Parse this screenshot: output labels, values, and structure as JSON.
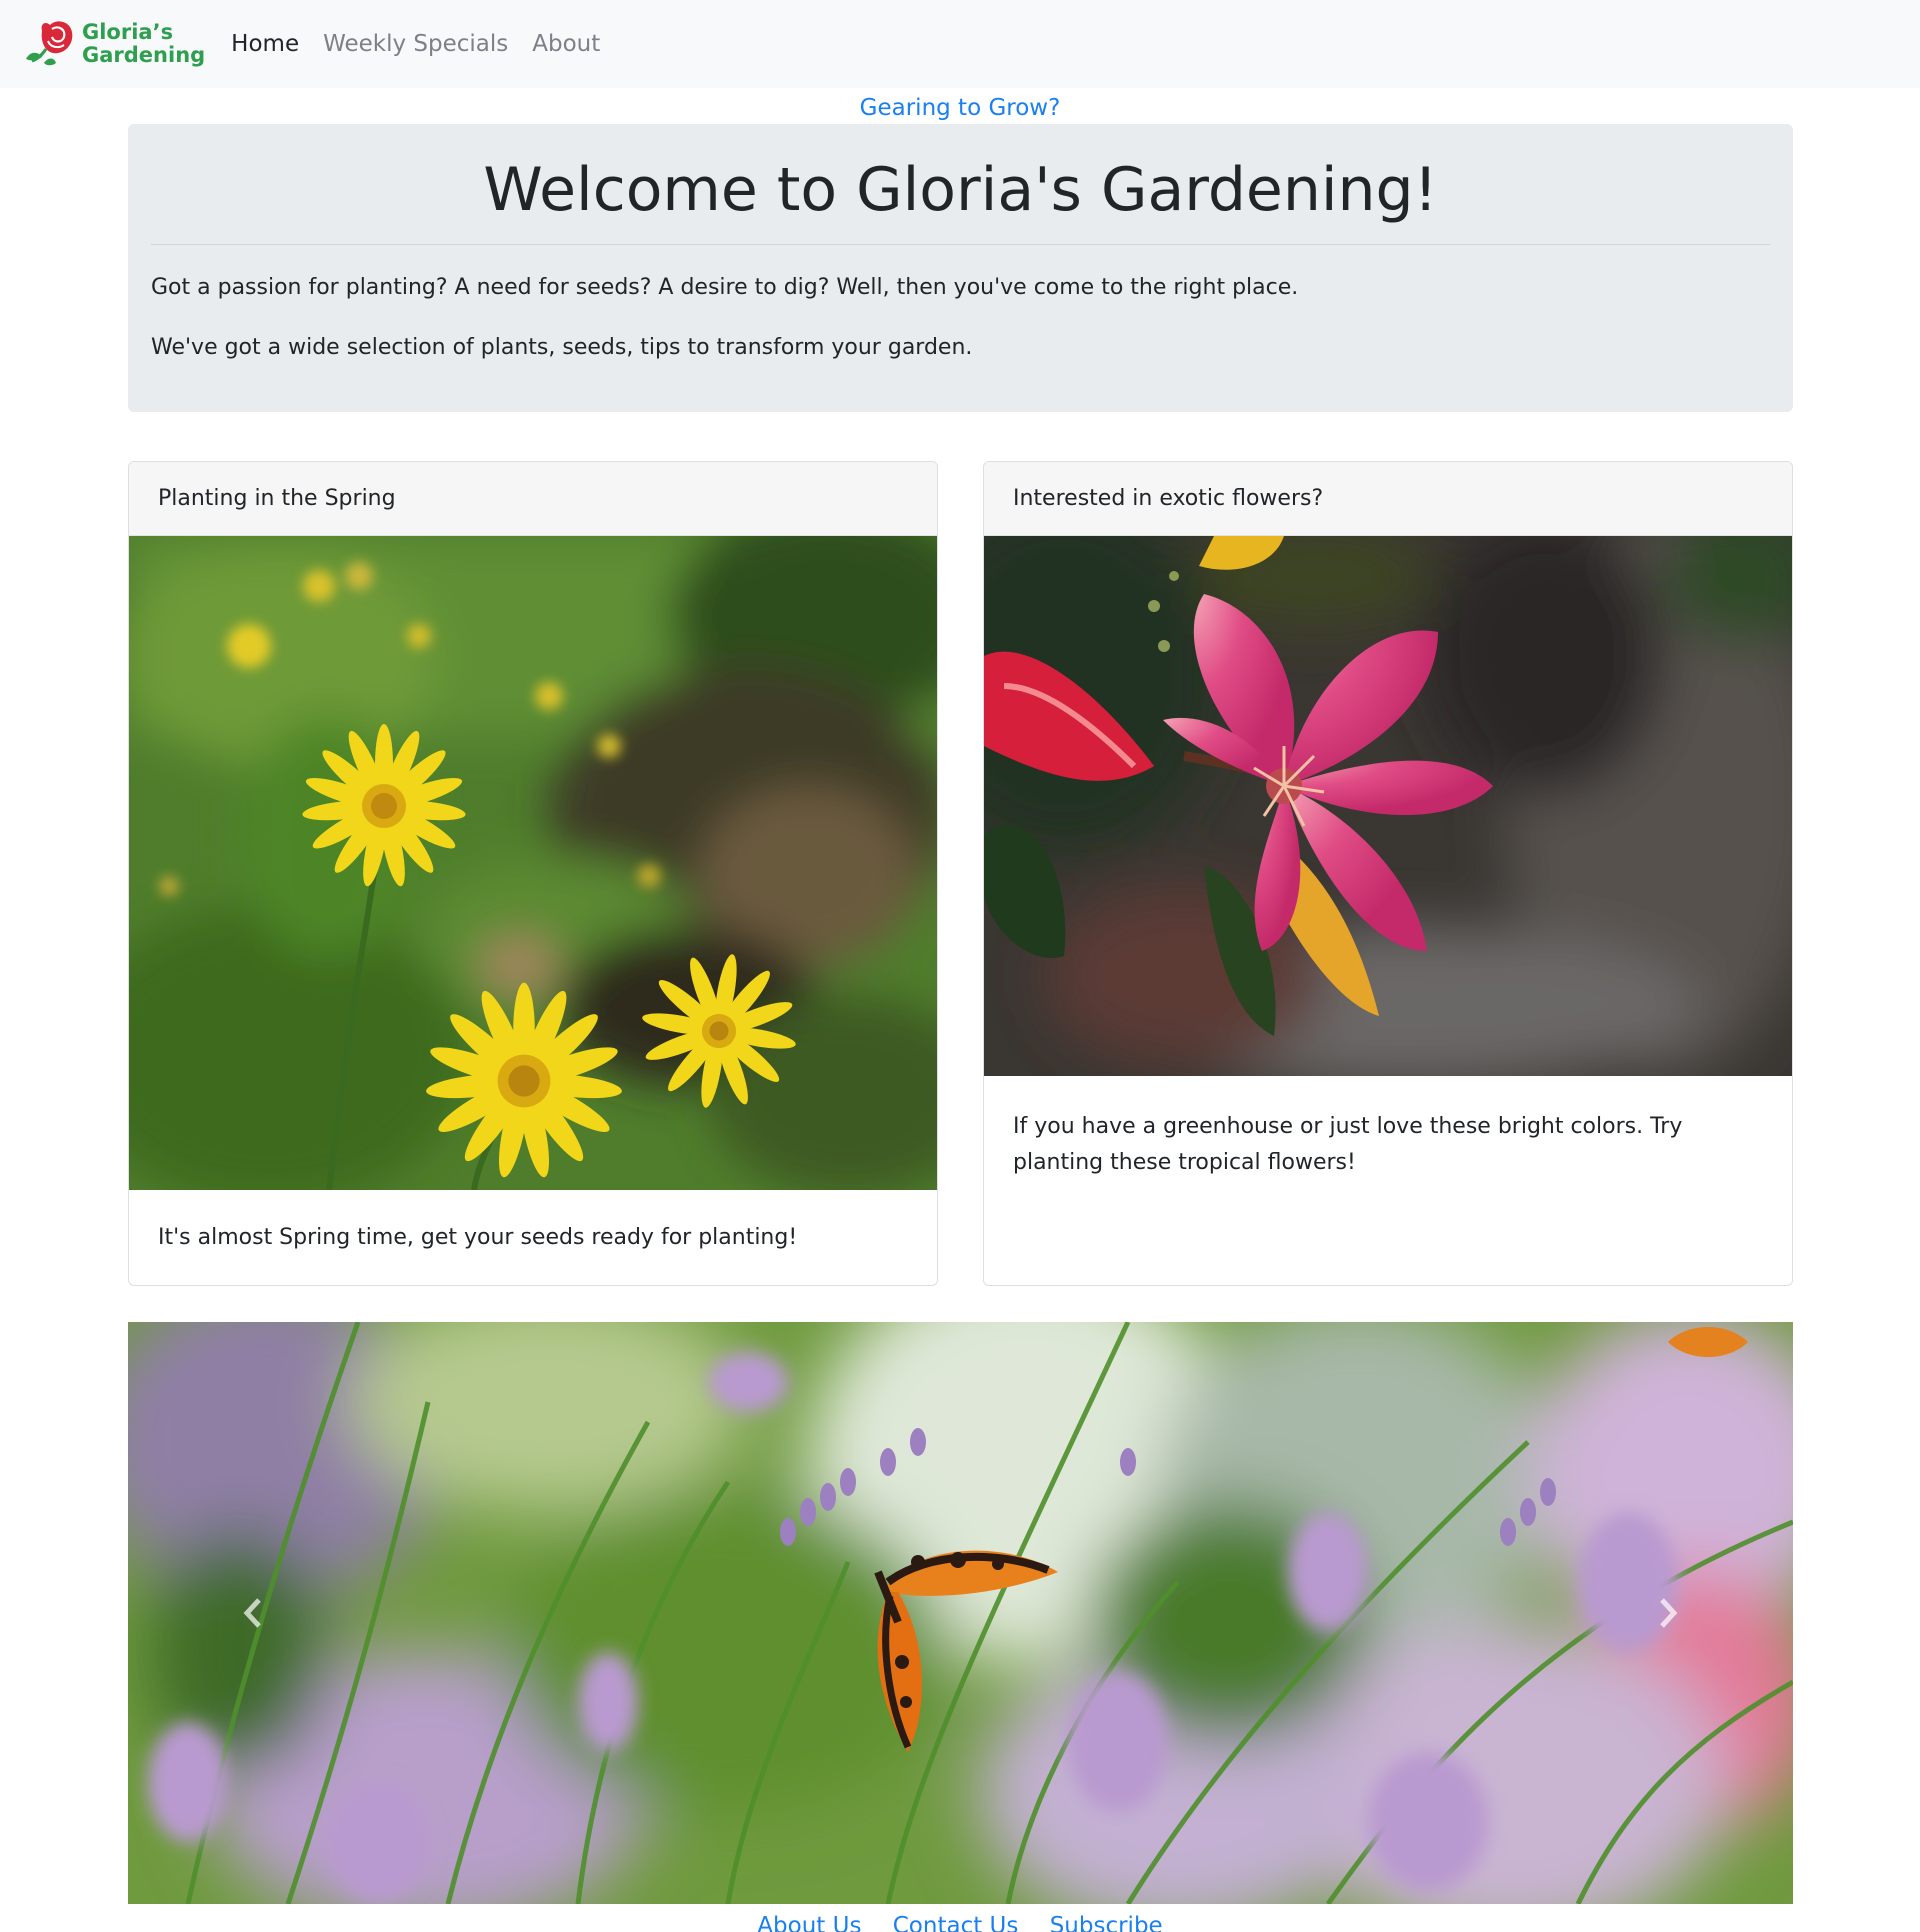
{
  "nav": {
    "brand_line1": "Gloria’s",
    "brand_line2": "Gardening",
    "links": [
      {
        "label": "Home",
        "active": true
      },
      {
        "label": "Weekly Specials",
        "active": false
      },
      {
        "label": "About",
        "active": false
      }
    ]
  },
  "teaser": "Gearing to Grow?",
  "jumbotron": {
    "title": "Welcome to Gloria's Gardening!",
    "paragraph1": "Got a passion for planting? A need for seeds? A desire to dig? Well, then you've come to the right place.",
    "paragraph2": "We've got a wide selection of plants, seeds, tips to transform your garden."
  },
  "cards": [
    {
      "header": "Planting in the Spring",
      "body": "It's almost Spring time, get your seeds ready for planting!"
    },
    {
      "header": "Interested in exotic flowers?",
      "body": "If you have a greenhouse or just love these bright colors. Try planting these tropical flowers!"
    }
  ],
  "carousel": {
    "prev_icon": "chevron-left-icon",
    "next_icon": "chevron-right-icon"
  },
  "footer": {
    "links": [
      "About Us",
      "Contact Us",
      "Subscribe"
    ]
  },
  "colors": {
    "brand_green": "#2e9e4f",
    "rose_red": "#d8283a",
    "link_blue": "#1a7ff0",
    "navbar_bg": "#f8f9fa",
    "jumbotron_bg": "#e9ecef"
  }
}
